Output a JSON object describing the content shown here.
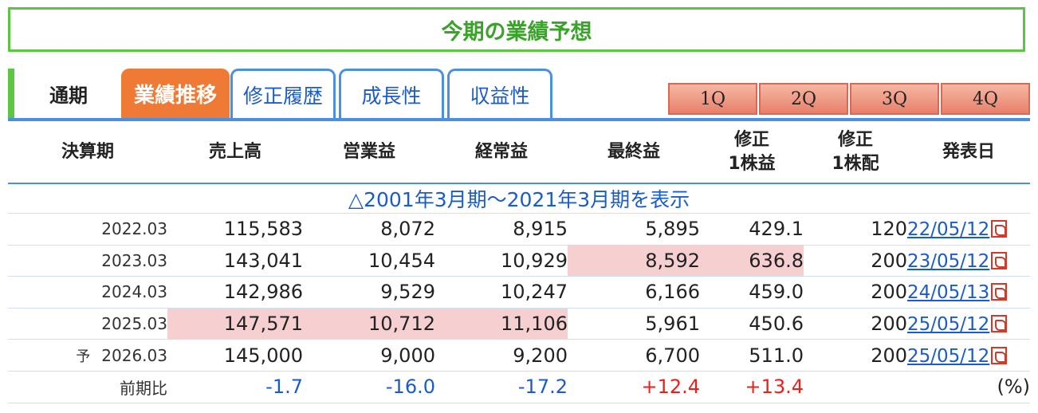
{
  "title": "今期の業績予想",
  "tabs": {
    "period": "通期",
    "active": "業績推移",
    "links": [
      "修正履歴",
      "成長性",
      "収益性"
    ],
    "quarters": [
      "1Q",
      "2Q",
      "3Q",
      "4Q"
    ]
  },
  "table": {
    "headers": [
      "決算期",
      "売上高",
      "営業益",
      "経常益",
      "最終益",
      "修正\n1株益",
      "修正\n1株配",
      "発表日"
    ],
    "toggle": "△2001年3月期～2021年3月期を表示",
    "rows": [
      {
        "mark": "",
        "period": "2022.03",
        "sales": "115,583",
        "op": "8,072",
        "ord": "8,915",
        "net": "5,895",
        "eps": "429.1",
        "dps": "120",
        "date": "22/05/12"
      },
      {
        "mark": "",
        "period": "2023.03",
        "sales": "143,041",
        "op": "10,454",
        "ord": "10,929",
        "net": "8,592",
        "eps": "636.8",
        "dps": "200",
        "date": "23/05/12"
      },
      {
        "mark": "",
        "period": "2024.03",
        "sales": "142,986",
        "op": "9,529",
        "ord": "10,247",
        "net": "6,166",
        "eps": "459.0",
        "dps": "200",
        "date": "24/05/13"
      },
      {
        "mark": "",
        "period": "2025.03",
        "sales": "147,571",
        "op": "10,712",
        "ord": "11,106",
        "net": "5,961",
        "eps": "450.6",
        "dps": "200",
        "date": "25/05/12"
      },
      {
        "mark": "予",
        "period": "2026.03",
        "sales": "145,000",
        "op": "9,000",
        "ord": "9,200",
        "net": "6,700",
        "eps": "511.0",
        "dps": "200",
        "date": "25/05/12"
      }
    ],
    "ratio": {
      "label": "前期比",
      "sales": "-1.7",
      "op": "-16.0",
      "ord": "-17.2",
      "net": "+12.4",
      "eps": "+13.4",
      "unit": "(%)"
    }
  },
  "colors": {
    "green": "#5cc543",
    "orange": "#ef7a35",
    "blue": "#1a5cc8",
    "highlight": "#f6cfd1",
    "red": "#e8211b"
  }
}
